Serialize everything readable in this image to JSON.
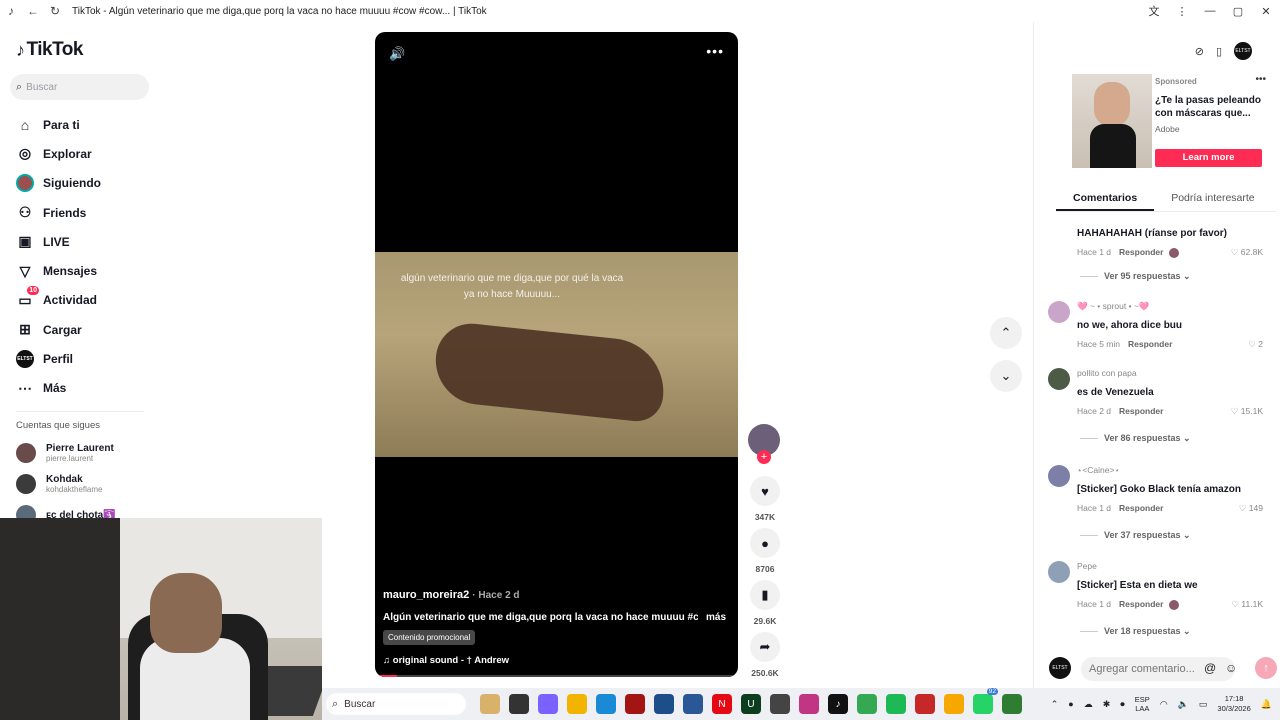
{
  "window": {
    "title": "TikTok - Algún veterinario que me diga,que porq la vaca no hace muuuu #cow #cow... | TikTok"
  },
  "sidebar": {
    "logo": "TikTok",
    "search_placeholder": "Buscar",
    "nav": [
      {
        "label": "Para ti",
        "icon": "home-icon"
      },
      {
        "label": "Explorar",
        "icon": "compass-icon"
      },
      {
        "label": "Siguiendo",
        "icon": "avatar-icon"
      },
      {
        "label": "Friends",
        "icon": "friends-icon"
      },
      {
        "label": "LIVE",
        "icon": "live-icon"
      },
      {
        "label": "Mensajes",
        "icon": "messages-icon"
      },
      {
        "label": "Actividad",
        "icon": "activity-icon",
        "badge": "10"
      },
      {
        "label": "Cargar",
        "icon": "upload-icon"
      },
      {
        "label": "Perfil",
        "icon": "profile-icon"
      },
      {
        "label": "Más",
        "icon": "more-icon"
      }
    ],
    "following_title": "Cuentas que sigues",
    "accounts": [
      {
        "name": "Pierre Laurent",
        "username": "pierre.laurent"
      },
      {
        "name": "Kohdak",
        "username": "kohdaktheflame"
      },
      {
        "name": "ᴇᴄ del chota🛐",
        "username": ""
      }
    ]
  },
  "video": {
    "overlay_caption": "algún veterinario que me diga,que por qué la vaca ya no hace Muuuuu...",
    "author": "mauro_moreira2",
    "time": "· Hace 2 d",
    "description": "Algún veterinario que me diga,que porq la vaca no hace muuuu #cow ...",
    "more": "más",
    "promo": "Contenido promocional",
    "sound": "♫  original sound - † Andrew",
    "progress_fraction": 0.06
  },
  "actions": {
    "likes": "347K",
    "comments": "8706",
    "saves": "29.6K",
    "shares": "250.6K"
  },
  "ad": {
    "sponsored": "Sponsored",
    "title": "¿Te la pasas peleando con máscaras que...",
    "brand": "Adobe",
    "cta": "Learn more"
  },
  "tabs": [
    "Comentarios",
    "Podría interesarte"
  ],
  "comments": [
    {
      "user": "",
      "text": "HAHAHAHAH (ríanse por favor)",
      "time": "Hace 1 d",
      "reply": "Responder",
      "likes": "♡ 62.8K",
      "replies": "Ver 95 respuestas ⌄"
    },
    {
      "user": "🩷 ~ • sprout • ~🩷",
      "text": "no we, ahora dice buu",
      "time": "Hace 5 min",
      "reply": "Responder",
      "likes": "♡ 2",
      "replies": ""
    },
    {
      "user": "pollito con papa",
      "text": "es de Venezuela",
      "time": "Hace 2 d",
      "reply": "Responder",
      "likes": "♡ 15.1K",
      "replies": "Ver 86 respuestas ⌄"
    },
    {
      "user": "⋆<Caine>⋆",
      "text": "[Sticker] Goko Black tenía amazon",
      "time": "Hace 1 d",
      "reply": "Responder",
      "likes": "♡ 149",
      "replies": "Ver 37 respuestas ⌄"
    },
    {
      "user": "Pepe",
      "text": "[Sticker] Esta en dieta we",
      "time": "Hace 1 d",
      "reply": "Responder",
      "likes": "♡ 11.1K",
      "replies": "Ver 18 respuestas ⌄"
    }
  ],
  "composer": {
    "placeholder": "Agregar comentario..."
  },
  "taskbar": {
    "search": "Buscar",
    "lang": "ESP",
    "lang2": "LAA",
    "time": "17:18",
    "date": "30/3/2026",
    "whatsapp_badge": "92"
  },
  "colors": {
    "accent": "#fe2c55",
    "text": "#161823"
  }
}
